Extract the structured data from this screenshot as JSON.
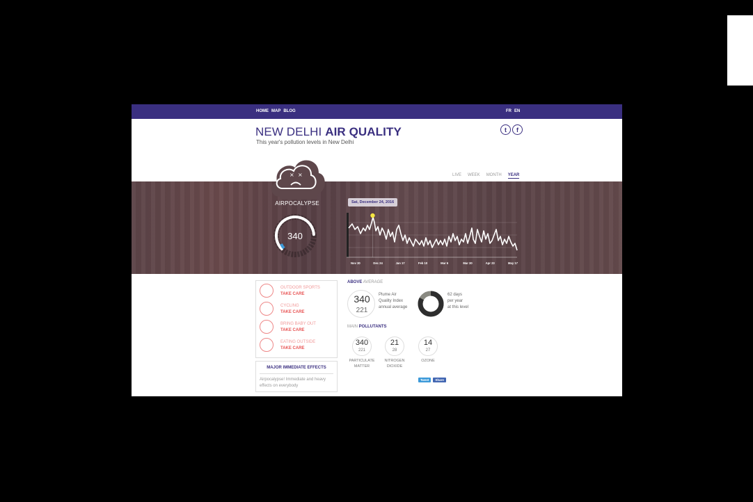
{
  "nav": {
    "left": [
      "HOME",
      "MAP",
      "BLOG"
    ],
    "right": [
      "FR",
      "EN"
    ]
  },
  "header": {
    "title_light": "NEW DELHI",
    "title_bold": "AIR QUALITY",
    "subtitle": "This year's pollution levels in New Delhi",
    "social": [
      {
        "icon": "twitter-icon",
        "glyph": "t"
      },
      {
        "icon": "facebook-icon",
        "glyph": "f"
      }
    ]
  },
  "range_tabs": {
    "items": [
      "LIVE",
      "WEEK",
      "MONTH",
      "YEAR"
    ],
    "active": "YEAR"
  },
  "status": {
    "label": "AIRPOCALYPSE",
    "aqi": "340",
    "gauge_level": 0.82,
    "icon": "sad-cloud-icon"
  },
  "timeline": {
    "selected_date": "Sat, December 24, 2016",
    "ticks": [
      "Nov 30",
      "Dec 24",
      "Jan 17",
      "Feb 10",
      "Mar 6",
      "Mar 30",
      "Apr 23",
      "May 17"
    ],
    "highlight_color": "#f5e642"
  },
  "recommendations": [
    {
      "icon": "sports-icon",
      "title": "OUTDOOR SPORTS",
      "status": "TAKE CARE"
    },
    {
      "icon": "cycling-icon",
      "title": "CYCLING",
      "status": "TAKE CARE"
    },
    {
      "icon": "baby-icon",
      "title": "BRING BABY OUT",
      "status": "TAKE CARE"
    },
    {
      "icon": "dining-icon",
      "title": "EATING OUTSIDE",
      "status": "TAKE CARE"
    }
  ],
  "effects": {
    "title": "MAJOR IMMEDIATE EFFECTS",
    "text": "Airpocalypse! Immediate and heavy effects on everybody"
  },
  "average": {
    "label_bold": "ABOVE",
    "label_light": "AVERAGE",
    "current": "340",
    "annual": "221",
    "desc": [
      "Plume Air",
      "Quality Index",
      "annual average"
    ],
    "days_fraction": 0.17,
    "days_desc": [
      "62 days",
      "per year",
      "at this level"
    ]
  },
  "pollutants": {
    "label_light": "MAIN",
    "label_bold": "POLLUTANTS",
    "items": [
      {
        "value": "340",
        "avg": "221",
        "name": [
          "PARTICULATE",
          "MATTER"
        ]
      },
      {
        "value": "21",
        "avg": "28",
        "name": [
          "NITROGEN",
          "DIOXIDE"
        ]
      },
      {
        "value": "14",
        "avg": "27",
        "name": [
          "OZONE",
          ""
        ]
      }
    ]
  },
  "share": {
    "tweet": "Tweet",
    "facebook": "Share"
  },
  "colors": {
    "brand": "#3a2f80",
    "warning": "#e85454",
    "gauge_accent": "#3d9ad9"
  }
}
